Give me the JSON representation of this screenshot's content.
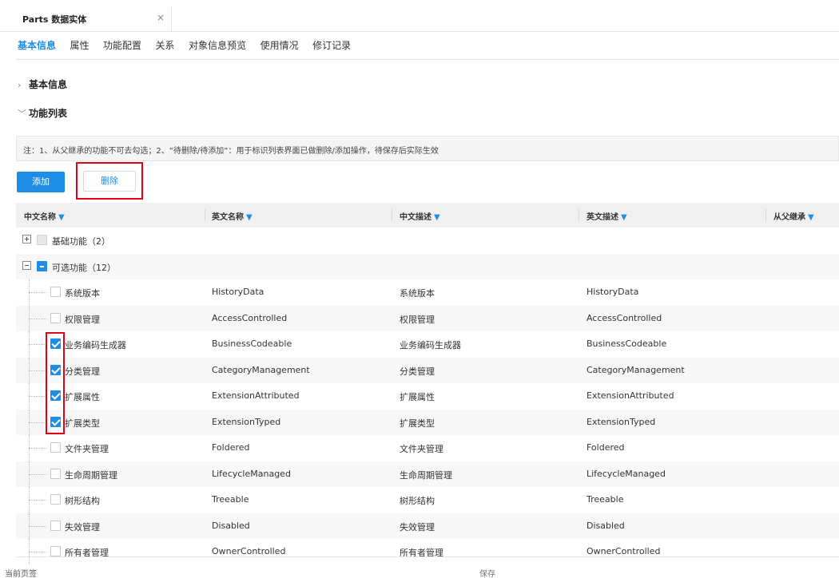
{
  "tab": {
    "title": "Parts 数据实体",
    "close": "×"
  },
  "subtabs": [
    "基本信息",
    "属性",
    "功能配置",
    "关系",
    "对象信息预览",
    "使用情况",
    "修订记录"
  ],
  "sections": {
    "basic": {
      "chevron": "›",
      "label": "基本信息"
    },
    "features": {
      "chevron": "﹀",
      "label": "功能列表"
    }
  },
  "note": "注：1、从父继承的功能不可去勾选；2、“待删除/待添加”：用于标识列表界面已做删除/添加操作，待保存后实际生效",
  "buttons": {
    "add": "添加",
    "delete": "删除"
  },
  "columns": [
    "中文名称",
    "英文名称",
    "中文描述",
    "英文描述",
    "从父继承"
  ],
  "filter_icon": "▼",
  "groups": [
    {
      "label": "基础功能（2）"
    },
    {
      "label": "可选功能（12）"
    }
  ],
  "rows": [
    {
      "cn": "系统版本",
      "en": "HistoryData",
      "cn_desc": "系统版本",
      "en_desc": "HistoryData",
      "checked": false
    },
    {
      "cn": "权限管理",
      "en": "AccessControlled",
      "cn_desc": "权限管理",
      "en_desc": "AccessControlled",
      "checked": false
    },
    {
      "cn": "业务编码生成器",
      "en": "BusinessCodeable",
      "cn_desc": "业务编码生成器",
      "en_desc": "BusinessCodeable",
      "checked": true
    },
    {
      "cn": "分类管理",
      "en": "CategoryManagement",
      "cn_desc": "分类管理",
      "en_desc": "CategoryManagement",
      "checked": true
    },
    {
      "cn": "扩展属性",
      "en": "ExtensionAttributed",
      "cn_desc": "扩展属性",
      "en_desc": "ExtensionAttributed",
      "checked": true
    },
    {
      "cn": "扩展类型",
      "en": "ExtensionTyped",
      "cn_desc": "扩展类型",
      "en_desc": "ExtensionTyped",
      "checked": true
    },
    {
      "cn": "文件夹管理",
      "en": "Foldered",
      "cn_desc": "文件夹管理",
      "en_desc": "Foldered",
      "checked": false
    },
    {
      "cn": "生命周期管理",
      "en": "LifecycleManaged",
      "cn_desc": "生命周期管理",
      "en_desc": "LifecycleManaged",
      "checked": false
    },
    {
      "cn": "树形结构",
      "en": "Treeable",
      "cn_desc": "树形结构",
      "en_desc": "Treeable",
      "checked": false
    },
    {
      "cn": "失效管理",
      "en": "Disabled",
      "cn_desc": "失效管理",
      "en_desc": "Disabled",
      "checked": false
    },
    {
      "cn": "所有者管理",
      "en": "OwnerControlled",
      "cn_desc": "所有者管理",
      "en_desc": "OwnerControlled",
      "checked": false
    }
  ],
  "footer": {
    "left": "当前页签",
    "save": "保存"
  },
  "colors": {
    "accent": "#1e8de6",
    "highlight": "#e1001a"
  }
}
